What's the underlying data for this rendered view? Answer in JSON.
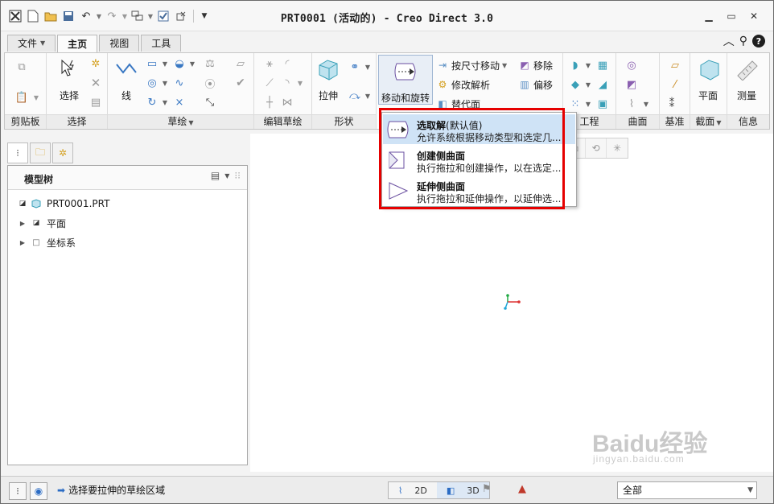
{
  "window": {
    "title": "PRT0001 (活动的) - Creo Direct 3.0"
  },
  "quick_access": {
    "icons": [
      "app-icon",
      "new-icon",
      "open-icon",
      "save-icon",
      "undo-icon",
      "redo-icon",
      "regenerate-icon",
      "window-icon",
      "close-window-icon",
      "customize-icon"
    ]
  },
  "tabs": [
    {
      "label": "文件",
      "has_dropdown": true
    },
    {
      "label": "主页",
      "active": true
    },
    {
      "label": "视图"
    },
    {
      "label": "工具"
    }
  ],
  "ribbon": {
    "groups": {
      "clipboard": "剪贴板",
      "select": "选择",
      "sketch": "草绘",
      "edit_sketch": "编辑草绘",
      "shape": "形状",
      "engineering": "工程",
      "surface": "曲面",
      "datum": "基准",
      "section": "截面",
      "info": "信息"
    },
    "buttons": {
      "select": "选择",
      "line": "线",
      "extrude": "拉伸",
      "move_rotate": "移动和旋转",
      "move_by_dimension": "按尺寸移动",
      "modify_analysis": "修改解析",
      "replace_surface": "替代面",
      "remove": "移除",
      "offset": "偏移",
      "plane": "平面",
      "measure": "测量"
    }
  },
  "dropdown": {
    "items": [
      {
        "title": "选取解",
        "suffix": "(默认值)",
        "desc": "允许系统根据移动类型和选定几...",
        "highlighted": true
      },
      {
        "title": "创建侧曲面",
        "desc": "执行拖拉和创建操作，以在选定..."
      },
      {
        "title": "延伸侧曲面",
        "desc": "执行拖拉和延伸操作，以延伸选..."
      }
    ]
  },
  "model_tree": {
    "title": "模型树",
    "items": [
      {
        "label": "PRT0001.PRT",
        "icon": "part-icon"
      },
      {
        "label": "平面",
        "icon": "plane-icon",
        "expandable": true
      },
      {
        "label": "坐标系",
        "icon": "csys-icon",
        "expandable": true
      }
    ]
  },
  "statusbar": {
    "message": "选择要拉伸的草绘区域",
    "mode_2d": "2D",
    "mode_3d": "3D",
    "filter_value": "全部"
  },
  "watermark": {
    "brand": "Baidu经验",
    "url": "jingyan.baidu.com"
  },
  "colors": {
    "highlight": "#cfe3f6",
    "callout_red": "#e60000",
    "accent_blue": "#3a78c3"
  }
}
